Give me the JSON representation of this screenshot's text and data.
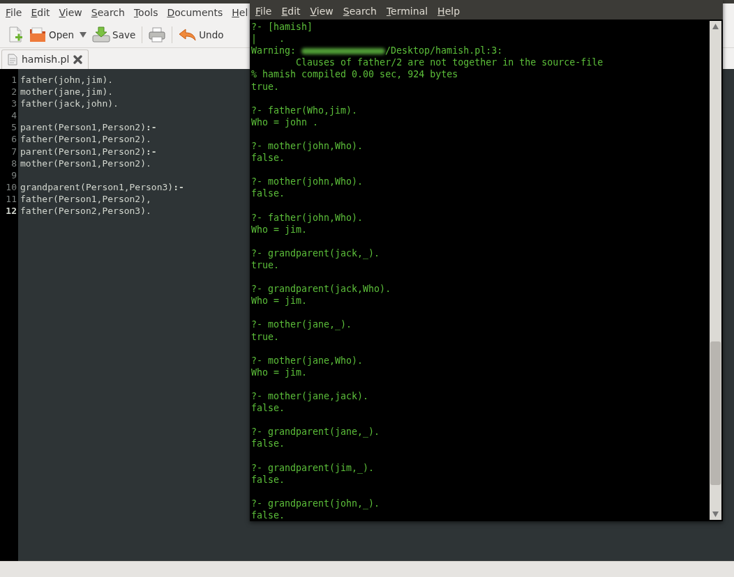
{
  "editor": {
    "menu": [
      "File",
      "Edit",
      "View",
      "Search",
      "Tools",
      "Documents",
      "Hel"
    ],
    "toolbar": [
      {
        "kind": "new"
      },
      {
        "kind": "open",
        "label": "Open"
      },
      {
        "kind": "caret"
      },
      {
        "kind": "save",
        "label": "Save"
      },
      {
        "kind": "separator"
      },
      {
        "kind": "print"
      },
      {
        "kind": "separator"
      },
      {
        "kind": "undo",
        "label": "Undo"
      }
    ],
    "tabs": [
      {
        "label": "hamish.pl",
        "selected": true
      }
    ],
    "lines": [
      {
        "number": "1",
        "code": "father(john,jim)."
      },
      {
        "number": "2",
        "code": "mother(jane,jim)."
      },
      {
        "number": "3",
        "code": "father(jack,john)."
      },
      {
        "number": "4"
      },
      {
        "number": "5",
        "code": "parent(Person1,Person2)**:-**"
      },
      {
        "number": "6",
        "code": "father(Person1,Person2)."
      },
      {
        "number": "7",
        "code": "parent(Person1,Person2)**:-**"
      },
      {
        "number": "8",
        "code": "mother(Person1,Person2)."
      },
      {
        "number": "9"
      },
      {
        "number": "10",
        "code": "grandparent(Person1,Person3)**:-**"
      },
      {
        "number": "11",
        "code": "father(Person1,Person2),"
      },
      {
        "number": "12",
        "code": "father(Person2,Person3).",
        "current": true
      }
    ]
  },
  "terminal": {
    "menu": [
      "File",
      "Edit",
      "View",
      "Search",
      "Terminal",
      "Help"
    ],
    "lines": [
      {
        "kind": "text",
        "text": "?- [hamish]"
      },
      {
        "kind": "text",
        "text": "|    ."
      },
      {
        "kind": "warning",
        "prefix": "Warning: ",
        "suffix": "/Desktop/hamish.pl:3:"
      },
      {
        "kind": "text",
        "text": "        Clauses of father/2 are not together in the source-file"
      },
      {
        "kind": "text",
        "text": "% hamish compiled 0.00 sec, 924 bytes"
      },
      {
        "kind": "text",
        "text": "true."
      },
      {
        "kind": "blank"
      },
      {
        "kind": "text",
        "text": "?- father(Who,jim)."
      },
      {
        "kind": "text",
        "text": "Who = john ."
      },
      {
        "kind": "blank"
      },
      {
        "kind": "text",
        "text": "?- mother(john,Who)."
      },
      {
        "kind": "text",
        "text": "false."
      },
      {
        "kind": "blank"
      },
      {
        "kind": "text",
        "text": "?- mother(john,Who)."
      },
      {
        "kind": "text",
        "text": "false."
      },
      {
        "kind": "blank"
      },
      {
        "kind": "text",
        "text": "?- father(john,Who)."
      },
      {
        "kind": "text",
        "text": "Who = jim."
      },
      {
        "kind": "blank"
      },
      {
        "kind": "text",
        "text": "?- grandparent(jack,_)."
      },
      {
        "kind": "text",
        "text": "true."
      },
      {
        "kind": "blank"
      },
      {
        "kind": "text",
        "text": "?- grandparent(jack,Who)."
      },
      {
        "kind": "text",
        "text": "Who = jim."
      },
      {
        "kind": "blank"
      },
      {
        "kind": "text",
        "text": "?- mother(jane,_)."
      },
      {
        "kind": "text",
        "text": "true."
      },
      {
        "kind": "blank"
      },
      {
        "kind": "text",
        "text": "?- mother(jane,Who)."
      },
      {
        "kind": "text",
        "text": "Who = jim."
      },
      {
        "kind": "blank"
      },
      {
        "kind": "text",
        "text": "?- mother(jane,jack)."
      },
      {
        "kind": "text",
        "text": "false."
      },
      {
        "kind": "blank"
      },
      {
        "kind": "text",
        "text": "?- grandparent(jane,_)."
      },
      {
        "kind": "text",
        "text": "false."
      },
      {
        "kind": "blank"
      },
      {
        "kind": "text",
        "text": "?- grandparent(jim,_)."
      },
      {
        "kind": "text",
        "text": "false."
      },
      {
        "kind": "blank"
      },
      {
        "kind": "text",
        "text": "?- grandparent(john,_)."
      },
      {
        "kind": "text",
        "text": "false."
      }
    ]
  }
}
